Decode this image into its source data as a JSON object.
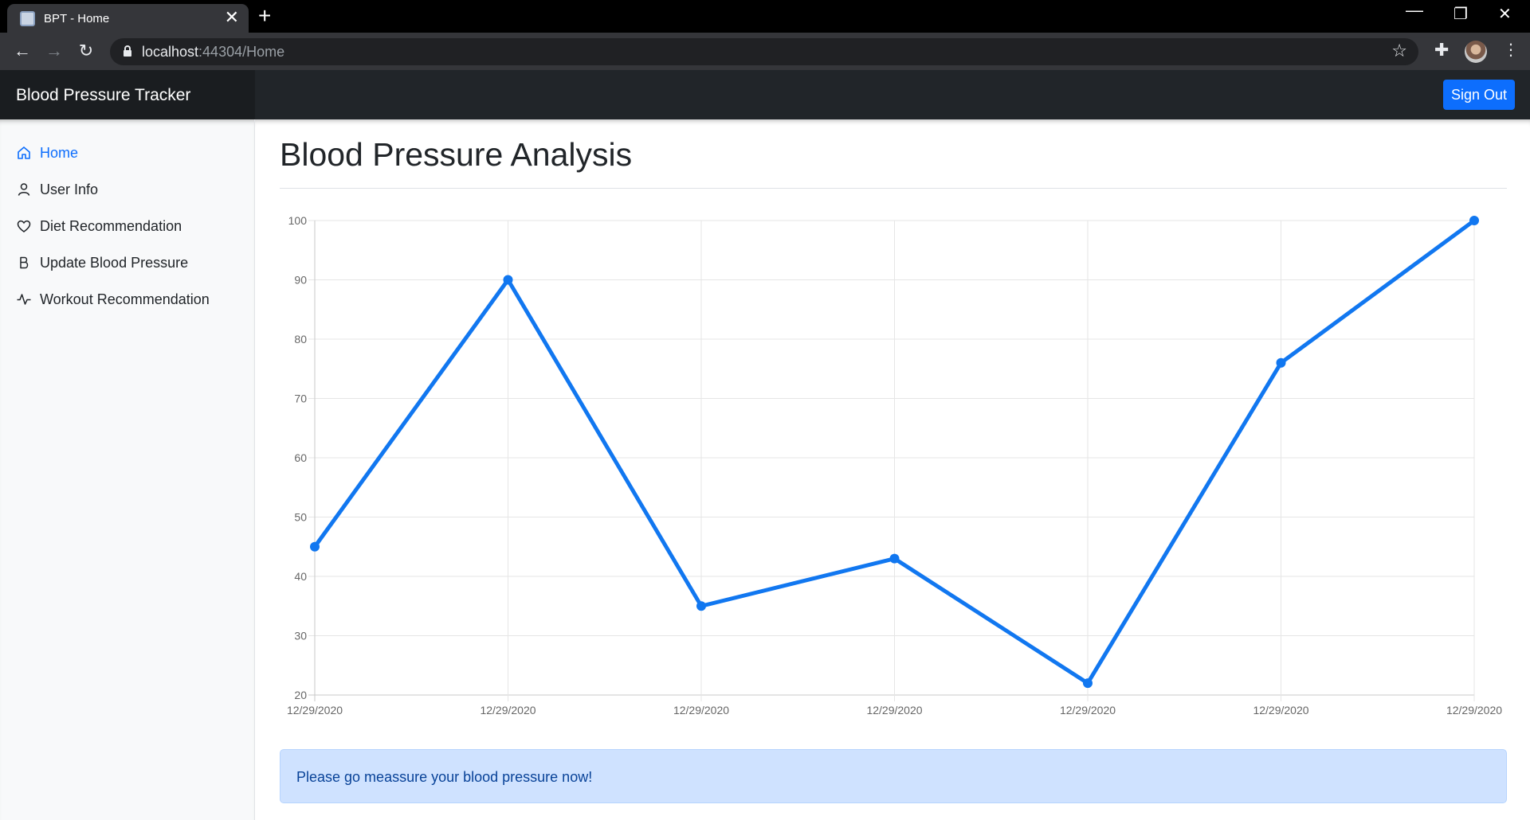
{
  "browser": {
    "tab_title": "BPT - Home",
    "tab_close": "✕",
    "new_tab": "+",
    "url_host": "localhost",
    "url_rest": ":44304/Home"
  },
  "app": {
    "brand": "Blood Pressure Tracker",
    "sign_out": "Sign Out"
  },
  "sidebar": {
    "items": [
      {
        "label": "Home",
        "icon": "house-icon",
        "active": true
      },
      {
        "label": "User Info",
        "icon": "person-icon",
        "active": false
      },
      {
        "label": "Diet Recommendation",
        "icon": "heart-icon",
        "active": false
      },
      {
        "label": "Update Blood Pressure",
        "icon": "bold-b-icon",
        "active": false
      },
      {
        "label": "Workout Recommendation",
        "icon": "activity-icon",
        "active": false
      }
    ]
  },
  "main": {
    "title": "Blood Pressure Analysis",
    "alert": "Please go meassure your blood pressure now!"
  },
  "colors": {
    "accent": "#0d6efd",
    "line": "#1177f0",
    "navbar": "#212529",
    "alert_bg": "#cfe2ff"
  },
  "chart_data": {
    "type": "line",
    "categories": [
      "12/29/2020",
      "12/29/2020",
      "12/29/2020",
      "12/29/2020",
      "12/29/2020",
      "12/29/2020",
      "12/29/2020"
    ],
    "series": [
      {
        "values": [
          45,
          90,
          35,
          43,
          22,
          76,
          100
        ]
      }
    ],
    "yticks": [
      20,
      30,
      40,
      50,
      60,
      70,
      80,
      90,
      100
    ],
    "ylim": [
      20,
      100
    ],
    "grid": true,
    "legend": "none"
  }
}
